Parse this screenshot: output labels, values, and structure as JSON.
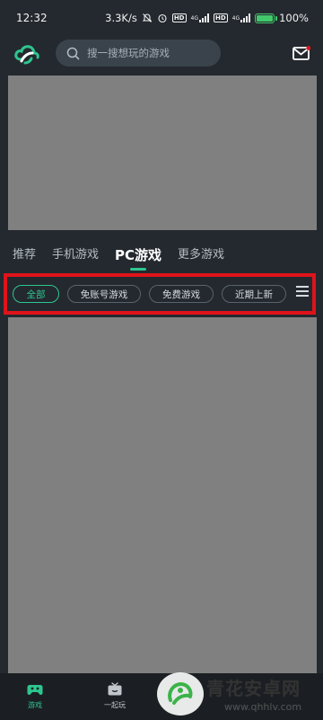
{
  "status_bar": {
    "time": "12:32",
    "network_speed": "3.3K/s",
    "battery_percent": "100%",
    "battery_level": 1.0,
    "net_label_1": "4G",
    "net_label_2": "4G",
    "hd_label_1": "HD",
    "hd_label_2": "HD"
  },
  "header": {
    "search_placeholder": "搜一搜想玩的游戏",
    "logo_icon": "cloud-game-logo-icon",
    "mail_icon": "mail-icon"
  },
  "tabs": [
    {
      "label": "推荐",
      "active": false
    },
    {
      "label": "手机游戏",
      "active": false
    },
    {
      "label": "PC游戏",
      "active": true
    },
    {
      "label": "更多游戏",
      "active": false
    }
  ],
  "filters": [
    {
      "label": "全部",
      "active": true
    },
    {
      "label": "免账号游戏",
      "active": false
    },
    {
      "label": "免费游戏",
      "active": false
    },
    {
      "label": "近期上新",
      "active": false
    }
  ],
  "bottom_nav": [
    {
      "label": "游戏",
      "active": true,
      "icon": "gamepad-icon"
    },
    {
      "label": "一起玩",
      "active": false,
      "icon": "tv-icon"
    }
  ],
  "watermark": {
    "title": "青花安卓网",
    "url": "www.qhhlv.com"
  },
  "colors": {
    "accent": "#2ec58f",
    "background": "#24292f",
    "highlight_box": "#e0131b",
    "placeholder": "#808080"
  }
}
